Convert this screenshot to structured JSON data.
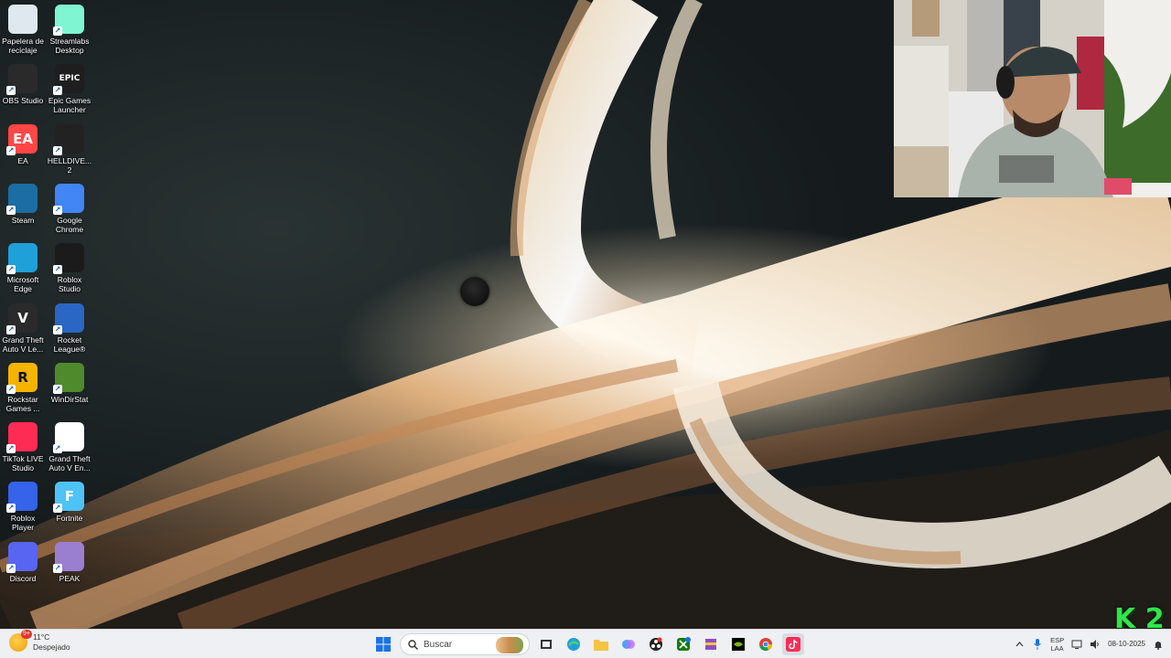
{
  "desktop": {
    "icons": [
      {
        "label": "Papelera de reciclaje",
        "icon": "recycle-bin-icon",
        "color": "#dfe7ef"
      },
      {
        "label": "Streamlabs Desktop",
        "icon": "streamlabs-icon",
        "color": "#80f5d2"
      },
      {
        "label": "OBS Studio",
        "icon": "obs-icon",
        "color": "#2a2a2a"
      },
      {
        "label": "Epic Games Launcher",
        "icon": "epic-games-icon",
        "color": "#1e1e1e",
        "glyph": "EPIC"
      },
      {
        "label": "EA",
        "icon": "ea-icon",
        "color": "#ff4747",
        "glyph": "EA"
      },
      {
        "label": "HELLDIVE... 2",
        "icon": "helldivers-icon",
        "color": "#222222"
      },
      {
        "label": "Steam",
        "icon": "steam-icon",
        "color": "#1b6da3"
      },
      {
        "label": "Google Chrome",
        "icon": "chrome-icon",
        "color": "#4285f4"
      },
      {
        "label": "Microsoft Edge",
        "icon": "edge-icon",
        "color": "#1fa0d8"
      },
      {
        "label": "Roblox Studio",
        "icon": "roblox-studio-icon",
        "color": "#1b1b1b"
      },
      {
        "label": "Grand Theft Auto V Le...",
        "icon": "gta-v-icon",
        "color": "#2a2a2a",
        "glyph": "V"
      },
      {
        "label": "Rocket League®",
        "icon": "rocket-league-icon",
        "color": "#2a66c4"
      },
      {
        "label": "Rockstar Games ...",
        "icon": "rockstar-icon",
        "color": "#f5b400",
        "glyph": "R"
      },
      {
        "label": "WinDirStat",
        "icon": "windirstat-icon",
        "color": "#4f8a2c"
      },
      {
        "label": "TikTok LIVE Studio",
        "icon": "tiktok-live-icon",
        "color": "#fe2c55"
      },
      {
        "label": "Grand Theft Auto V En...",
        "icon": "file-icon",
        "color": "#ffffff"
      },
      {
        "label": "Roblox Player",
        "icon": "roblox-player-icon",
        "color": "#3563e9"
      },
      {
        "label": "Fortnite",
        "icon": "fortnite-icon",
        "color": "#4fc3f7",
        "glyph": "F"
      },
      {
        "label": "Discord",
        "icon": "discord-icon",
        "color": "#5865f2"
      },
      {
        "label": "PEAK",
        "icon": "peak-icon",
        "color": "#9a7fd0"
      }
    ]
  },
  "overlay": {
    "k2_logo": "K 2"
  },
  "taskbar": {
    "weather": {
      "badge": "9+",
      "temp": "11°C",
      "condition": "Despejado"
    },
    "search_placeholder": "Buscar",
    "apps": [
      {
        "icon": "windows-start-icon",
        "color": "#1a73e8"
      },
      {
        "icon": "search-icon"
      },
      {
        "icon": "task-view-icon",
        "color": "#333333"
      },
      {
        "icon": "edge-icon",
        "color": "#1fa0d8"
      },
      {
        "icon": "file-explorer-icon",
        "color": "#f4c542"
      },
      {
        "icon": "copilot-icon",
        "color": "#b86bff"
      },
      {
        "icon": "obs-icon",
        "color": "#222222"
      },
      {
        "icon": "xbox-icon",
        "color": "#107c10",
        "badge": "1"
      },
      {
        "icon": "winrar-icon",
        "color": "#8e4ec6"
      },
      {
        "icon": "nvidia-icon",
        "color": "#76b900"
      },
      {
        "icon": "chrome-icon",
        "color": "#4285f4"
      },
      {
        "icon": "tiktok-live-icon",
        "color": "#fe2c55"
      }
    ],
    "tray": {
      "lang_top": "ESP",
      "lang_bottom": "LAA",
      "date": "08-10-2025"
    }
  }
}
